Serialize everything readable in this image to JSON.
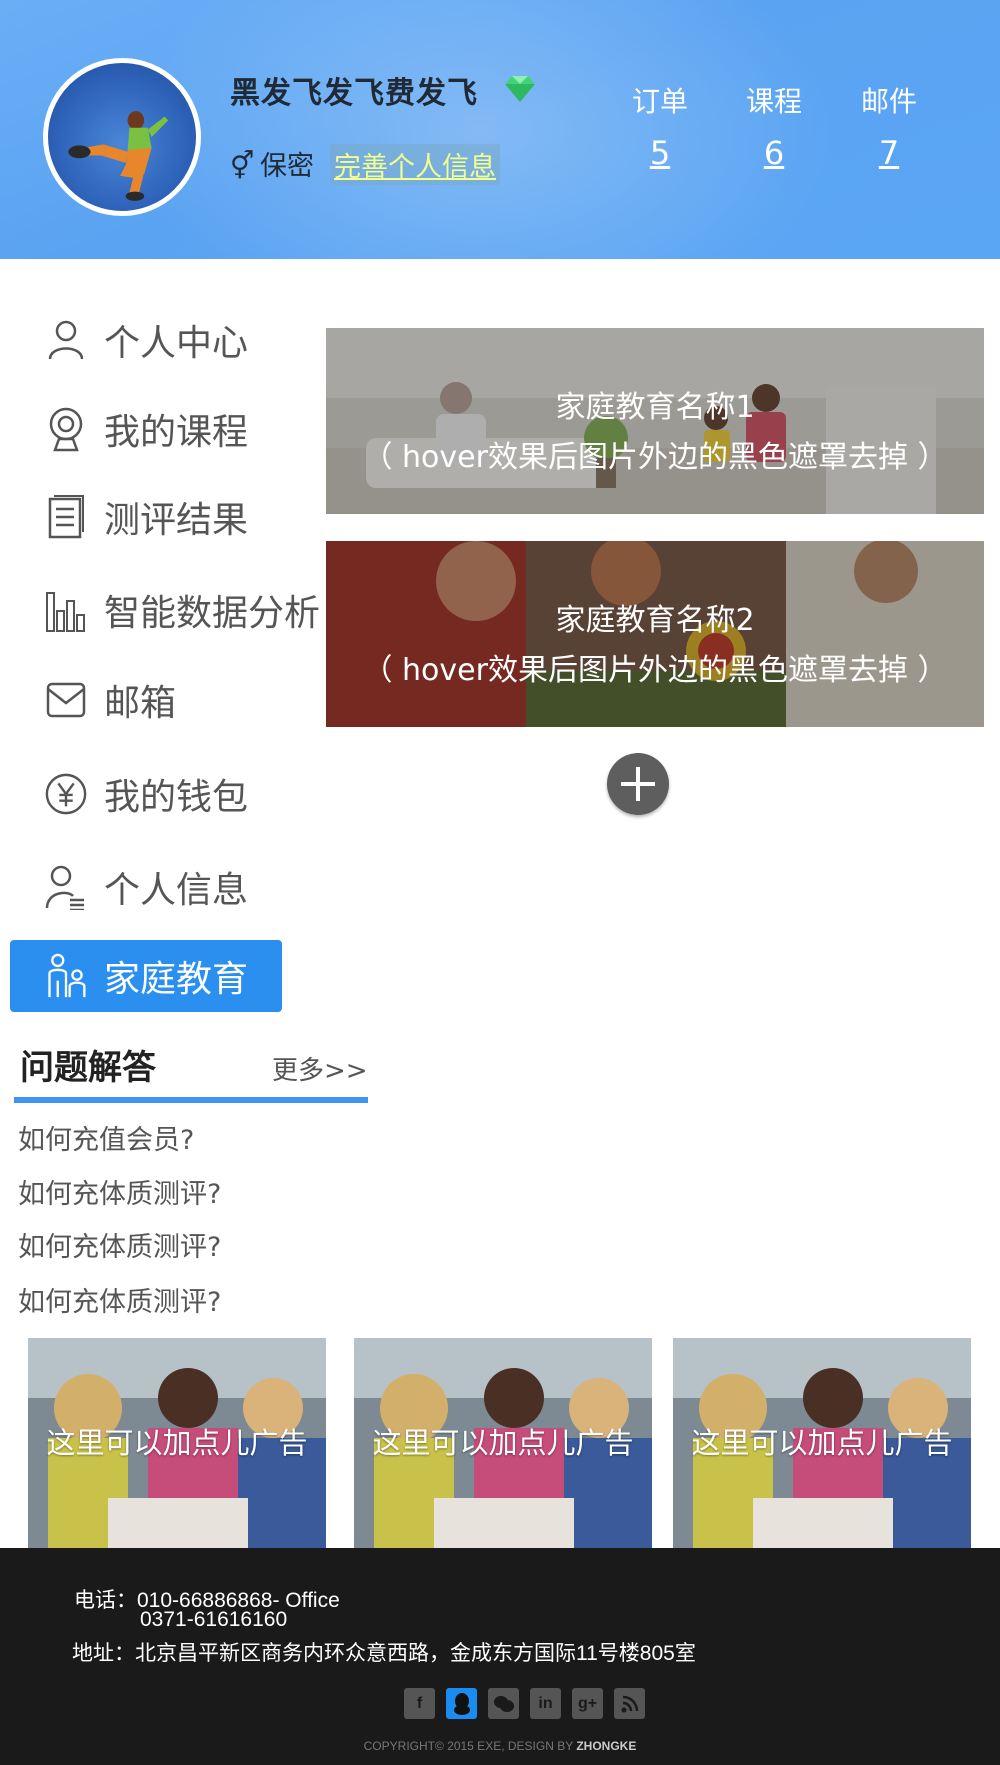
{
  "header": {
    "username": "黑发飞发飞费发飞",
    "gender": "保密",
    "complete_profile_link": "完善个人信息",
    "stats": [
      {
        "label": "订单",
        "value": "5"
      },
      {
        "label": "课程",
        "value": "6"
      },
      {
        "label": "邮件",
        "value": "7"
      }
    ]
  },
  "sidebar": {
    "items": [
      {
        "label": "个人中心",
        "icon": "user-icon"
      },
      {
        "label": "我的课程",
        "icon": "webcam-icon"
      },
      {
        "label": "测评结果",
        "icon": "document-icon"
      },
      {
        "label": "智能数据分析",
        "icon": "bar-chart-icon"
      },
      {
        "label": "邮箱",
        "icon": "mail-icon"
      },
      {
        "label": "我的钱包",
        "icon": "yen-icon"
      },
      {
        "label": "个人信息",
        "icon": "user-list-icon"
      },
      {
        "label": "家庭教育",
        "icon": "family-icon",
        "active": true
      }
    ]
  },
  "cards": [
    {
      "title": "家庭教育名称1",
      "note": "（ hover效果后图片外边的黑色遮罩去掉 ）"
    },
    {
      "title": "家庭教育名称2",
      "note": "（ hover效果后图片外边的黑色遮罩去掉 ）"
    }
  ],
  "faq": {
    "title": "问题解答",
    "more": "更多>>",
    "items": [
      "如何充值会员?",
      "如何充体质测评?",
      "如何充体质测评?",
      "如何充体质测评?"
    ]
  },
  "ads": [
    "这里可以加点儿广告",
    "这里可以加点儿广告",
    "这里可以加点儿广告"
  ],
  "footer": {
    "phone": "电话：010-66886868- Office",
    "phone2": "0371-61616160",
    "address": "地址：北京昌平新区商务内环众意西路，金成东方国际11号楼805室",
    "social": [
      "facebook-icon",
      "qq-icon",
      "wechat-icon",
      "linkedin-icon",
      "googleplus-icon",
      "rss-icon"
    ],
    "copyright_prefix": "COPYRIGHT© 2015 EXE, DESIGN BY",
    "copyright_brand": "ZHONGKE"
  },
  "colors": {
    "header_blue": "#5aa3f2",
    "active_blue": "#2b8ff0",
    "link_yellow": "#f2ff90",
    "footer_bg": "#1a1a1a"
  }
}
